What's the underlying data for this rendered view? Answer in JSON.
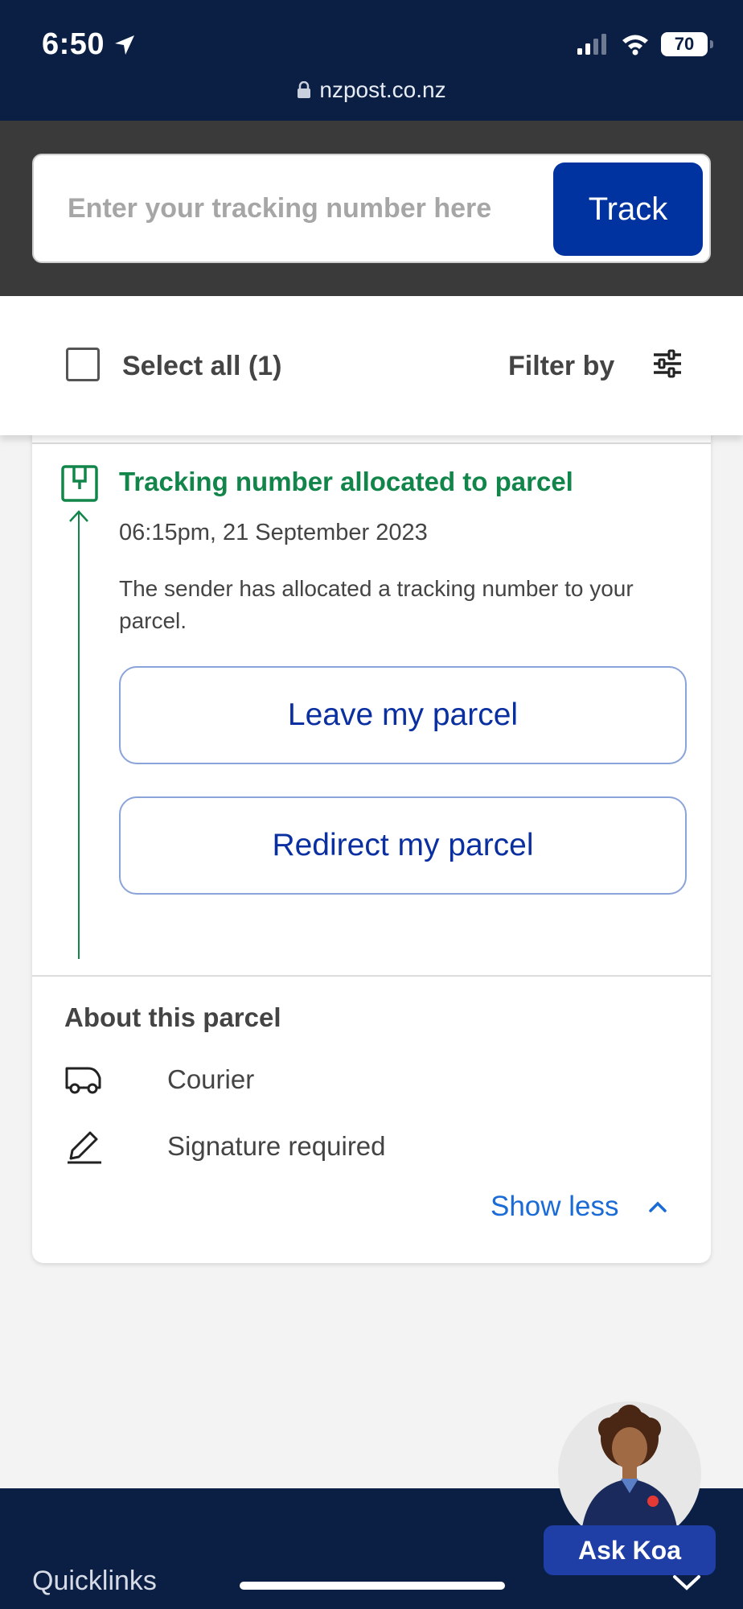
{
  "status_bar": {
    "time": "6:50",
    "battery": "70",
    "url": "nzpost.co.nz"
  },
  "search": {
    "placeholder": "Enter your tracking number here",
    "button_label": "Track"
  },
  "select_bar": {
    "select_all_label": "Select all (1)",
    "filter_label": "Filter by"
  },
  "event": {
    "title": "Tracking number allocated to parcel",
    "timestamp": "06:15pm, 21 September 2023",
    "description": "The sender has allocated a tracking number to your parcel.",
    "leave_button": "Leave my parcel",
    "redirect_button": "Redirect my parcel"
  },
  "about": {
    "title": "About this parcel",
    "service": "Courier",
    "requirement": "Signature required",
    "show_less": "Show less"
  },
  "footer": {
    "quicklinks": "Quicklinks",
    "ask_koa": "Ask Koa"
  },
  "colors": {
    "navy": "#0b1f45",
    "primary_blue": "#0033a0",
    "success_green": "#12854a",
    "link_blue": "#1a6bd6"
  }
}
